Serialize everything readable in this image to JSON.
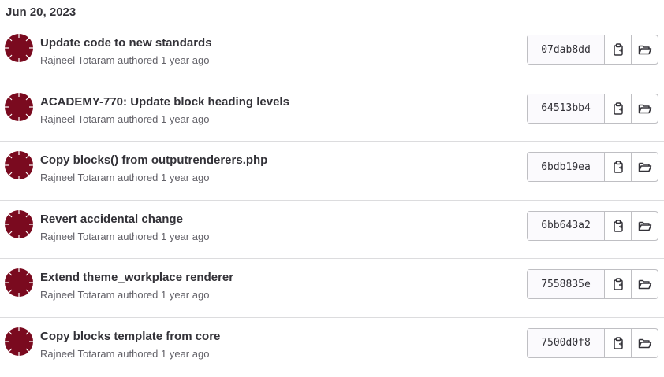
{
  "date_header": "Jun 20, 2023",
  "colors": {
    "avatar": "#7a0a1f",
    "avatar_edge": "#ffffff",
    "border": "#dcdcde",
    "text": "#333238",
    "muted": "#626168"
  },
  "commits": [
    {
      "title": "Update code to new standards",
      "author": "Rajneel Totaram",
      "authored_label": "authored",
      "time": "1 year ago",
      "sha": "07dab8dd",
      "copy_icon": "clipboard-icon",
      "browse_icon": "folder-open-icon"
    },
    {
      "title": "ACADEMY-770: Update block heading levels",
      "author": "Rajneel Totaram",
      "authored_label": "authored",
      "time": "1 year ago",
      "sha": "64513bb4",
      "copy_icon": "clipboard-icon",
      "browse_icon": "folder-open-icon"
    },
    {
      "title": "Copy blocks() from outputrenderers.php",
      "author": "Rajneel Totaram",
      "authored_label": "authored",
      "time": "1 year ago",
      "sha": "6bdb19ea",
      "copy_icon": "clipboard-icon",
      "browse_icon": "folder-open-icon"
    },
    {
      "title": "Revert accidental change",
      "author": "Rajneel Totaram",
      "authored_label": "authored",
      "time": "1 year ago",
      "sha": "6bb643a2",
      "copy_icon": "clipboard-icon",
      "browse_icon": "folder-open-icon"
    },
    {
      "title": "Extend theme_workplace renderer",
      "author": "Rajneel Totaram",
      "authored_label": "authored",
      "time": "1 year ago",
      "sha": "7558835e",
      "copy_icon": "clipboard-icon",
      "browse_icon": "folder-open-icon"
    },
    {
      "title": "Copy blocks template from core",
      "author": "Rajneel Totaram",
      "authored_label": "authored",
      "time": "1 year ago",
      "sha": "7500d0f8",
      "copy_icon": "clipboard-icon",
      "browse_icon": "folder-open-icon"
    }
  ]
}
